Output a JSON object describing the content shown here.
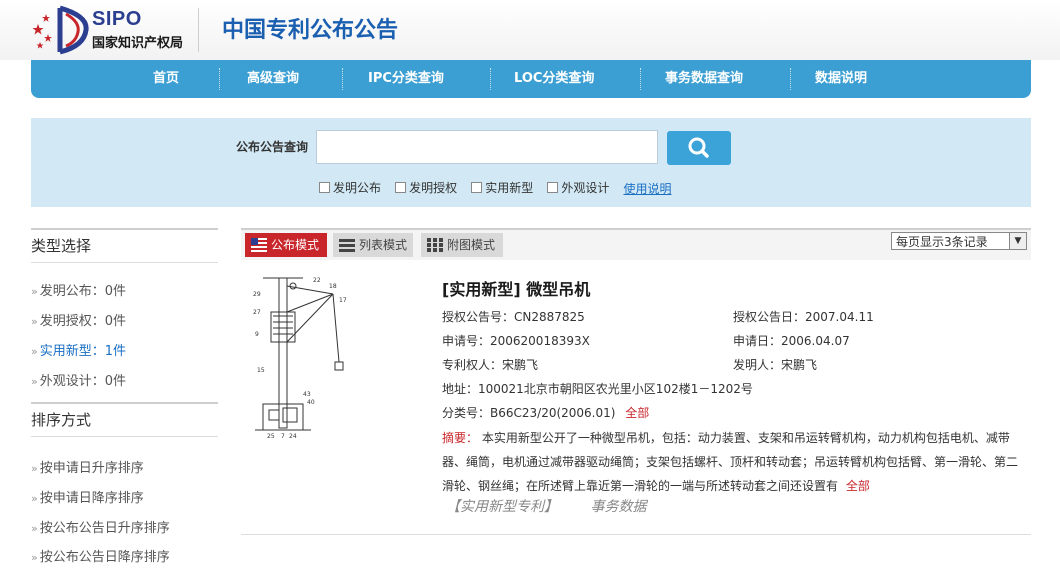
{
  "header": {
    "logo_en": "SIPO",
    "logo_cn": "国家知识产权局",
    "site_title": "中国专利公布公告"
  },
  "nav": {
    "items": [
      "首页",
      "高级查询",
      "IPC分类查询",
      "LOC分类查询",
      "事务数据查询",
      "数据说明"
    ]
  },
  "search": {
    "label": "公布公告查询",
    "value": "",
    "placeholder": "",
    "button_icon": "search-icon",
    "checkboxes": [
      {
        "label": "发明公布",
        "checked": false
      },
      {
        "label": "发明授权",
        "checked": false
      },
      {
        "label": "实用新型",
        "checked": false
      },
      {
        "label": "外观设计",
        "checked": false
      }
    ],
    "help_link": "使用说明"
  },
  "sidebar": {
    "type_heading": "类型选择",
    "type_items": [
      {
        "label": "发明公布：0件",
        "active": false
      },
      {
        "label": "发明授权：0件",
        "active": false
      },
      {
        "label": "实用新型：1件",
        "active": true
      },
      {
        "label": "外观设计：0件",
        "active": false
      }
    ],
    "sort_heading": "排序方式",
    "sort_items": [
      "按申请日升序排序",
      "按申请日降序排序",
      "按公布公告日升序排序",
      "按公布公告日降序排序"
    ]
  },
  "toolbar": {
    "modes": [
      "公布模式",
      "列表模式",
      "附图模式"
    ],
    "active_mode": "公布模式",
    "per_page": "每页显示3条记录"
  },
  "result": {
    "title": "[实用新型] 微型吊机",
    "grant_no": "授权公告号：CN2887825",
    "grant_date": "授权公告日：2007.04.11",
    "app_no": "申请号：200620018393X",
    "app_date": "申请日：2006.04.07",
    "patentee": "专利权人：宋鹏飞",
    "inventor": "发明人：宋鹏飞",
    "address": "地址：100021北京市朝阳区农光里小区102楼1－1202号",
    "class_no": "分类号：B66C23/20(2006.01)",
    "class_all": "全部",
    "abstract_label": "摘要：",
    "abstract_text": "本实用新型公开了一种微型吊机，包括：动力装置、支架和吊运转臂机构，动力机构包括电机、减带器、绳筒，电机通过减带器驱动绳筒；支架包括螺杆、顶杆和转动套；吊运转臂机构包括臂、第一滑轮、第二滑轮、钢丝绳；在所述臂上靠近第一滑轮的一端与所述转动套之间还设置有",
    "abstract_all": "全部",
    "tag_patent": "【实用新型专利】",
    "tag_affairs": "事务数据"
  },
  "colors": {
    "nav_bg": "#3b9fd3",
    "search_bg": "#d2e9f5",
    "accent_red": "#c8262b",
    "link_blue": "#1a6fc4"
  }
}
